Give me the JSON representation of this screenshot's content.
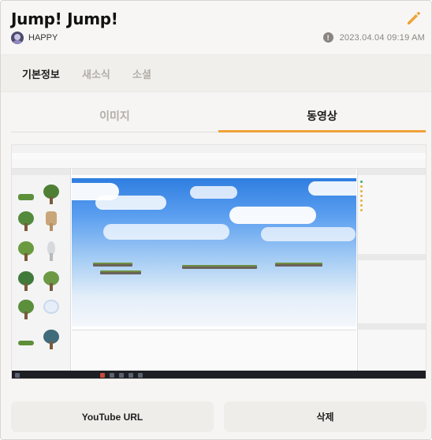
{
  "post": {
    "title": "Jump! Jump!",
    "author": "HAPPY",
    "date": "2023.04.04 09:19 AM"
  },
  "icons": {
    "edit": "pencil-icon",
    "info": "info-icon",
    "avatar": "avatar"
  },
  "colors": {
    "accent": "#f0a23a",
    "pencil": "#f0a23a",
    "muted_text": "#b3aea8"
  },
  "tabs": [
    {
      "label": "기본정보",
      "active": true
    },
    {
      "label": "새소식",
      "active": false
    },
    {
      "label": "소셜",
      "active": false
    }
  ],
  "media_tabs": [
    {
      "label": "이미지",
      "active": false
    },
    {
      "label": "동영상",
      "active": true
    }
  ],
  "info_glyph": "!",
  "actions": {
    "youtube_url": "YouTube URL",
    "delete": "삭제"
  }
}
